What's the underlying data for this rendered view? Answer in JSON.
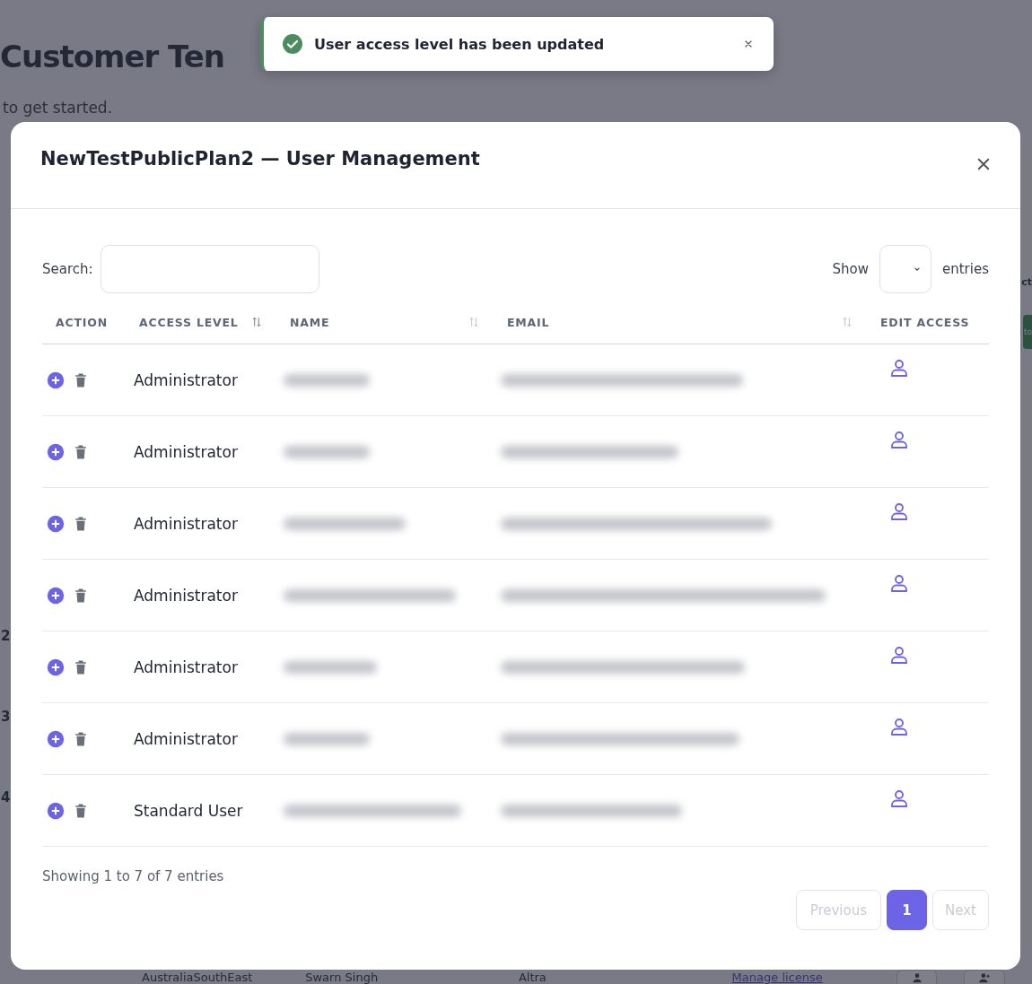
{
  "background": {
    "title": "Customer Ten",
    "subtitle": "to get started.",
    "right_label": "ct",
    "right_button": "to",
    "row_numbers": [
      "2",
      "3",
      "4"
    ],
    "bottom_row": {
      "region": "AustraliaSouthEast",
      "owner": "Swarn Singh",
      "company": "Altra",
      "link": "Manage license"
    }
  },
  "toast": {
    "kind": "success",
    "message": "User access level has been updated"
  },
  "modal": {
    "title": "NewTestPublicPlan2 — User Management",
    "search_label": "Search:",
    "show_label": "Show",
    "entries_label": "entries",
    "columns": [
      {
        "label": "ACTION",
        "sortable": false
      },
      {
        "label": "ACCESS LEVEL",
        "sortable": true
      },
      {
        "label": "NAME",
        "sortable": true
      },
      {
        "label": "EMAIL",
        "sortable": true
      },
      {
        "label": "EDIT ACCESS",
        "sortable": false
      }
    ],
    "rows": [
      {
        "access_level": "Administrator"
      },
      {
        "access_level": "Administrator"
      },
      {
        "access_level": "Administrator"
      },
      {
        "access_level": "Administrator"
      },
      {
        "access_level": "Administrator"
      },
      {
        "access_level": "Administrator"
      },
      {
        "access_level": "Standard User"
      }
    ],
    "info": "Showing 1 to 7 of 7 entries",
    "pagination": [
      {
        "kind": "prev",
        "label": "Previous",
        "disabled": true,
        "selected": false
      },
      {
        "kind": "page",
        "label": "1",
        "disabled": false,
        "selected": true
      },
      {
        "kind": "next",
        "label": "Next",
        "disabled": true,
        "selected": false
      }
    ]
  }
}
